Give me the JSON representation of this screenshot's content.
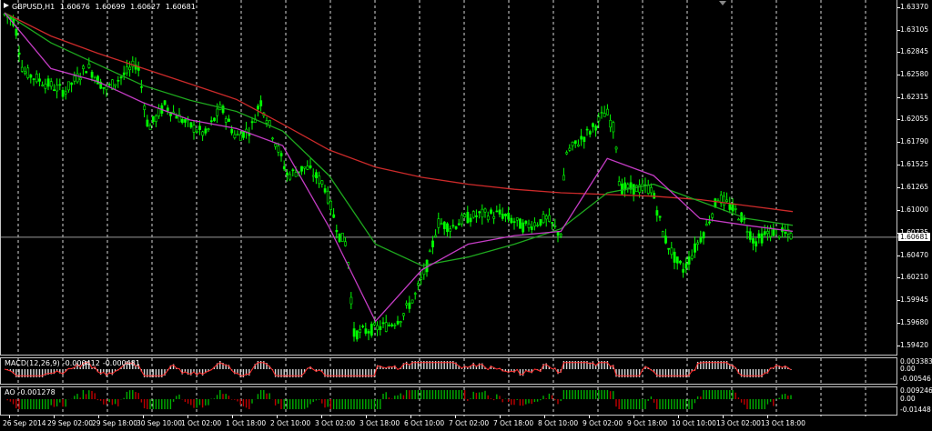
{
  "chart": {
    "symbol_label": "GBPUSD,H1",
    "ohlc": [
      "1.60676",
      "1.60699",
      "1.60627",
      "1.60681"
    ],
    "current_price": "1.60681",
    "price_scale": [
      "1.63370",
      "1.63105",
      "1.62845",
      "1.62580",
      "1.62315",
      "1.62055",
      "1.61790",
      "1.61525",
      "1.61265",
      "1.61000",
      "1.60735",
      "1.60470",
      "1.60210",
      "1.59945",
      "1.59680",
      "1.59420"
    ],
    "price_range": [
      1.593,
      1.6345
    ],
    "colors": {
      "bullish": "#00ff00",
      "bearish": "#00ff00",
      "ma_slow": "#cc2a2a",
      "ma_mid": "#1ea81e",
      "ma_fast": "#c43cc4",
      "grid": "#ffffff",
      "background": "#000000"
    }
  },
  "macd": {
    "label": "MACD(12,26,9)",
    "values": [
      "-0.000412",
      "-0.000481"
    ],
    "scale": [
      "0.003383",
      "0.00",
      "-0.00546"
    ]
  },
  "ao": {
    "label": "AO",
    "value": "-0.001278",
    "scale": [
      "0.009246",
      "0.00",
      "-0.01448"
    ]
  },
  "time_axis": [
    "26 Sep 2014",
    "29 Sep 02:00",
    "29 Sep 18:00",
    "30 Sep 10:00",
    "1 Oct 02:00",
    "1 Oct 18:00",
    "2 Oct 10:00",
    "3 Oct 02:00",
    "3 Oct 18:00",
    "6 Oct 10:00",
    "7 Oct 02:00",
    "7 Oct 18:00",
    "8 Oct 10:00",
    "9 Oct 02:00",
    "9 Oct 18:00",
    "10 Oct 10:00",
    "13 Oct 02:00",
    "13 Oct 18:00"
  ],
  "chart_data": {
    "type": "candlestick",
    "title": "GBPUSD,H1",
    "ylim": [
      1.5942,
      1.6337
    ],
    "moving_averages": [
      {
        "color": "#cc2a2a",
        "values": [
          1.633,
          1.6303,
          1.6283,
          1.6265,
          1.6247,
          1.6229,
          1.62,
          1.617,
          1.615,
          1.6138,
          1.613,
          1.6124,
          1.612,
          1.6118,
          1.6116,
          1.6112,
          1.6105,
          1.6098
        ]
      },
      {
        "color": "#1ea81e",
        "values": [
          1.633,
          1.6295,
          1.627,
          1.6245,
          1.6228,
          1.6215,
          1.6192,
          1.614,
          1.606,
          1.6035,
          1.6045,
          1.606,
          1.6078,
          1.612,
          1.613,
          1.611,
          1.609,
          1.6082
        ]
      },
      {
        "color": "#c43cc4",
        "values": [
          1.633,
          1.6265,
          1.625,
          1.6225,
          1.6205,
          1.6195,
          1.6175,
          1.608,
          1.597,
          1.603,
          1.606,
          1.607,
          1.6075,
          1.616,
          1.614,
          1.609,
          1.6082,
          1.6075
        ]
      }
    ]
  }
}
